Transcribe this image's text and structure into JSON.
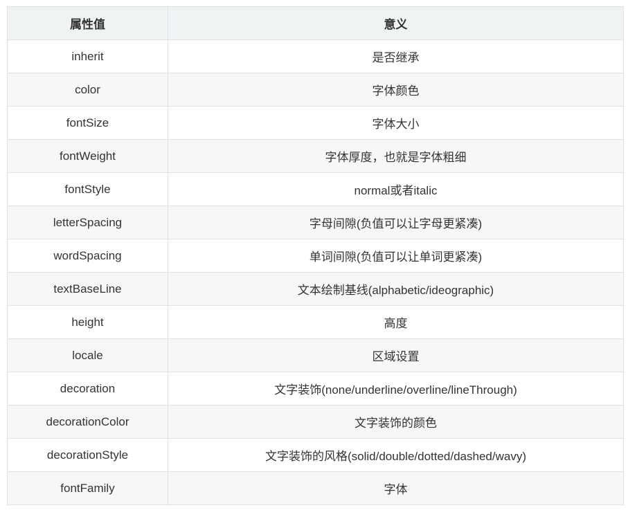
{
  "table": {
    "headers": [
      "属性值",
      "意义"
    ],
    "rows": [
      [
        "inherit",
        "是否继承"
      ],
      [
        "color",
        "字体颜色"
      ],
      [
        "fontSize",
        "字体大小"
      ],
      [
        "fontWeight",
        "字体厚度，也就是字体粗细"
      ],
      [
        "fontStyle",
        "normal或者italic"
      ],
      [
        "letterSpacing",
        "字母间隙(负值可以让字母更紧凑)"
      ],
      [
        "wordSpacing",
        "单词间隙(负值可以让单词更紧凑)"
      ],
      [
        "textBaseLine",
        "文本绘制基线(alphabetic/ideographic)"
      ],
      [
        "height",
        "高度"
      ],
      [
        "locale",
        "区域设置"
      ],
      [
        "decoration",
        "文字装饰(none/underline/overline/lineThrough)"
      ],
      [
        "decorationColor",
        "文字装饰的颜色"
      ],
      [
        "decorationStyle",
        "文字装饰的风格(solid/double/dotted/dashed/wavy)"
      ],
      [
        "fontFamily",
        "字体"
      ]
    ]
  },
  "colors": {
    "header_bg": "#f0f3f4",
    "row_alt_bg": "#f7f7f7",
    "border": "#dfe2e5",
    "text": "#333333"
  }
}
